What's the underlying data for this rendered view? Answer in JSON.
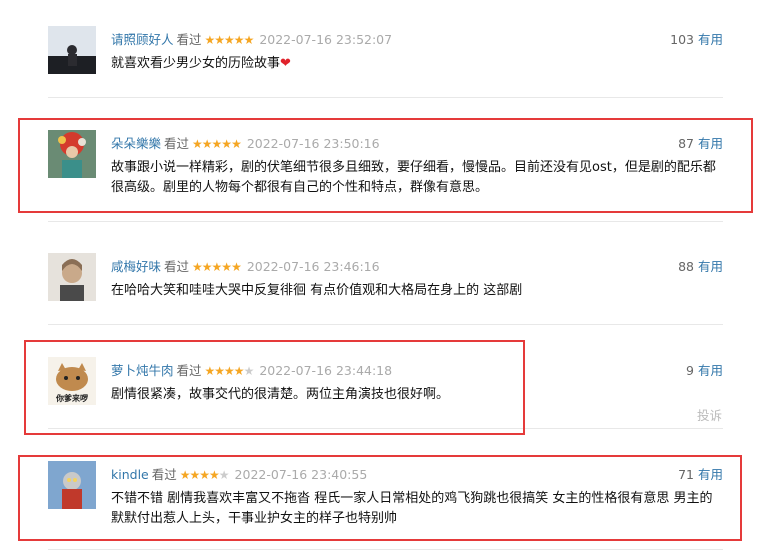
{
  "comments": [
    {
      "user": "请照顾好人",
      "watched": "看过",
      "rating": 5,
      "time": "2022-07-16 23:52:07",
      "votes": "103",
      "vote_label": "有用",
      "content": "就喜欢看少男少女的历险故事",
      "heart": "❤"
    },
    {
      "user": "朵朵樂樂",
      "watched": "看过",
      "rating": 5,
      "time": "2022-07-16 23:50:16",
      "votes": "87",
      "vote_label": "有用",
      "content": "故事跟小说一样精彩，剧的伏笔细节很多且细致，要仔细看，慢慢品。目前还没有见ost，但是剧的配乐都很高级。剧里的人物每个都很有自己的个性和特点，群像有意思。"
    },
    {
      "user": "咸梅好味",
      "watched": "看过",
      "rating": 5,
      "time": "2022-07-16 23:46:16",
      "votes": "88",
      "vote_label": "有用",
      "content": "在哈哈大笑和哇哇大哭中反复徘徊 有点价值观和大格局在身上的 这部剧"
    },
    {
      "user": "萝卜炖牛肉",
      "watched": "看过",
      "rating": 4,
      "time": "2022-07-16 23:44:18",
      "votes": "9",
      "vote_label": "有用",
      "content": "剧情很紧凑，故事交代的很清楚。两位主角演技也很好啊。",
      "report": "投诉",
      "avatar_text": "你爹来啰"
    },
    {
      "user": "kindle",
      "watched": "看过",
      "rating": 4,
      "time": "2022-07-16 23:40:55",
      "votes": "71",
      "vote_label": "有用",
      "content": "不错不错 剧情我喜欢丰富又不拖沓 程氏一家人日常相处的鸡飞狗跳也很搞笑 女主的性格很有意思 男主的默默付出惹人上头，干事业护女主的样子也特别帅"
    }
  ],
  "colors": {
    "highlight": "#e53a3a",
    "link": "#3377aa",
    "star": "#f5a623"
  }
}
